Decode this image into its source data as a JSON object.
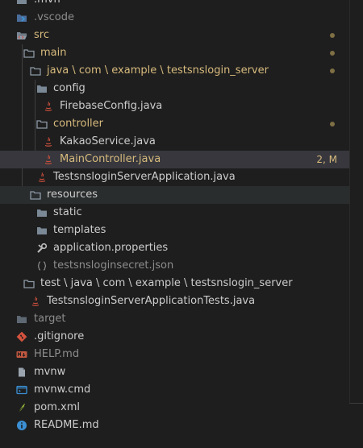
{
  "explorer": {
    "rows": [
      {
        "label": ".mvn",
        "kind": "folder",
        "style": "default"
      },
      {
        "label": ".vscode",
        "kind": "folder-vscode",
        "style": "dim"
      },
      {
        "label": "src",
        "kind": "folder-src",
        "style": "mod",
        "decoration": "dot"
      },
      {
        "label": "main",
        "kind": "folder",
        "style": "mod",
        "decoration": "dot"
      },
      {
        "label": "java \\ com \\ example \\ testsnslogin_server",
        "kind": "folder",
        "style": "mod",
        "decoration": "dot"
      },
      {
        "label": "config",
        "kind": "folder",
        "style": "default"
      },
      {
        "label": "FirebaseConfig.java",
        "kind": "java-file",
        "style": "default"
      },
      {
        "label": "controller",
        "kind": "folder",
        "style": "mod",
        "decoration": "dot"
      },
      {
        "label": "KakaoService.java",
        "kind": "java-file",
        "style": "default"
      },
      {
        "label": "MainController.java",
        "kind": "java-file",
        "style": "mod",
        "status": "2, M",
        "state": "selected"
      },
      {
        "label": "TestsnsloginServerApplication.java",
        "kind": "java-file",
        "style": "default"
      },
      {
        "label": "resources",
        "kind": "folder",
        "style": "default",
        "state": "hovered"
      },
      {
        "label": "static",
        "kind": "folder",
        "style": "default"
      },
      {
        "label": "templates",
        "kind": "folder",
        "style": "default"
      },
      {
        "label": "application.properties",
        "kind": "gear-file",
        "style": "default"
      },
      {
        "label": "testsnsloginsecret.json",
        "kind": "json-file",
        "style": "dim"
      },
      {
        "label": "test \\ java \\ com \\ example \\ testsnslogin_server",
        "kind": "folder",
        "style": "default"
      },
      {
        "label": "TestsnsloginServerApplicationTests.java",
        "kind": "java-file",
        "style": "default"
      },
      {
        "label": "target",
        "kind": "folder-target",
        "style": "dim"
      },
      {
        "label": ".gitignore",
        "kind": "git-file",
        "style": "default"
      },
      {
        "label": "HELP.md",
        "kind": "md-file",
        "style": "dim"
      },
      {
        "label": "mvnw",
        "kind": "plain-file",
        "style": "default"
      },
      {
        "label": "mvnw.cmd",
        "kind": "cmd-file",
        "style": "default"
      },
      {
        "label": "pom.xml",
        "kind": "xml-file",
        "style": "default"
      },
      {
        "label": "README.md",
        "kind": "info-file",
        "style": "default"
      }
    ]
  },
  "colors": {
    "background": "#1e1e1e",
    "modified": "#d7ba7d",
    "folder": "#7b8896",
    "java": "#c94f3c"
  }
}
